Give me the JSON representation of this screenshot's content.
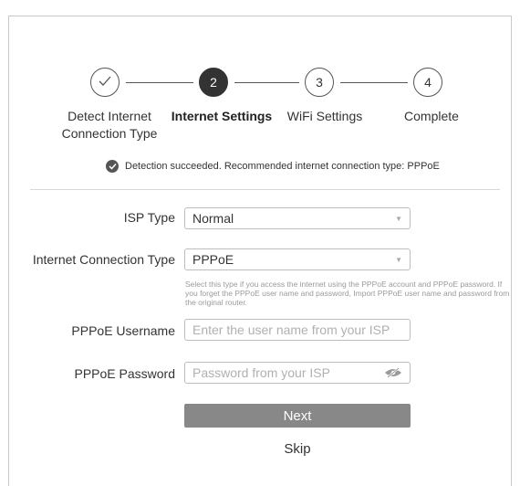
{
  "stepper": {
    "steps": [
      {
        "number": "✓",
        "label_line1": "Detect Internet",
        "label_line2": "Connection Type",
        "state": "done"
      },
      {
        "number": "2",
        "label_line1": "Internet Settings",
        "label_line2": "",
        "state": "active"
      },
      {
        "number": "3",
        "label_line1": "WiFi Settings",
        "label_line2": "",
        "state": "pending"
      },
      {
        "number": "4",
        "label_line1": "Complete",
        "label_line2": "",
        "state": "pending"
      }
    ]
  },
  "status": {
    "icon": "check-circle-icon",
    "text": "Detection succeeded. Recommended internet connection type: PPPoE"
  },
  "form": {
    "isp_type": {
      "label": "ISP Type",
      "value": "Normal"
    },
    "connection_type": {
      "label": "Internet Connection Type",
      "value": "PPPoE",
      "help": "Select this type if you access the internet using the PPPoE account and PPPoE password. If you forget the PPPoE user name and password, Import PPPoE user name and password from the original router."
    },
    "username": {
      "label": "PPPoE Username",
      "placeholder": "Enter the user name from your ISP",
      "value": ""
    },
    "password": {
      "label": "PPPoE Password",
      "placeholder": "Password from your ISP",
      "value": "",
      "toggle_icon": "eye-off-icon"
    }
  },
  "actions": {
    "next_label": "Next",
    "skip_label": "Skip"
  },
  "colors": {
    "accent": "#333333",
    "button": "#888888",
    "border": "#bdbdbd"
  }
}
